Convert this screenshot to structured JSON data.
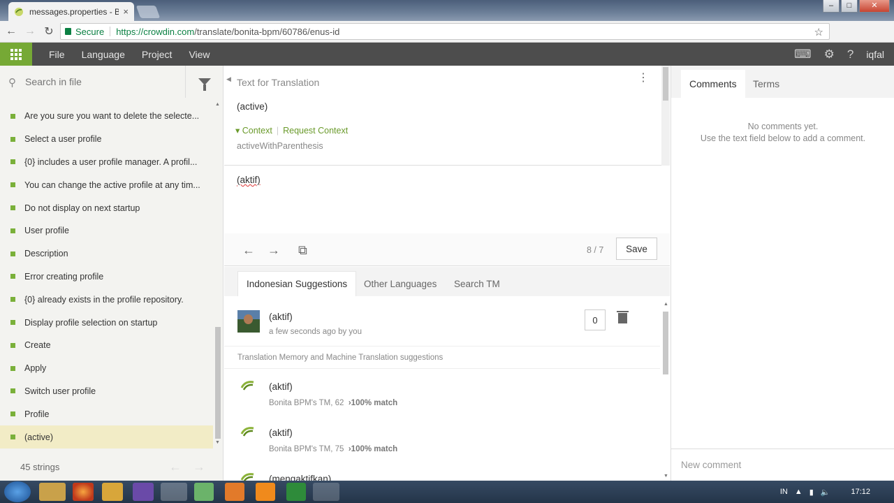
{
  "browser": {
    "tab_title": "messages.properties - Bonita",
    "tab_close": "×",
    "secure_label": "Secure",
    "url_host": "https://crowdin.com",
    "url_path": "/translate/bonita-bpm/60786/enus-id"
  },
  "appbar": {
    "menu": [
      "File",
      "Language",
      "Project",
      "View"
    ],
    "user": "iqfal"
  },
  "left": {
    "search_placeholder": "Search in file",
    "strings": [
      "Are you sure you want to delete the selecte...",
      "Select a user profile",
      "{0} includes a user profile manager. A profil...",
      "You can change the active profile at any tim...",
      "Do not display on next startup",
      "User profile",
      "Description",
      "Error creating profile",
      "{0} already exists in the profile repository.",
      "Display profile selection on startup",
      "Create",
      "Apply",
      "Switch user profile",
      "Profile",
      "(active)"
    ],
    "selected_index": 14,
    "count": "45 strings"
  },
  "editor": {
    "source_header": "Text for Translation",
    "source_text": "(active)",
    "context_label": "Context",
    "request_context": "Request Context",
    "context_key": "activeWithParenthesis",
    "translation": "(aktif)",
    "counter": "8 / 7",
    "save": "Save",
    "tabs": [
      "Indonesian Suggestions",
      "Other Languages",
      "Search TM"
    ],
    "my_suggestion": {
      "text": "(aktif)",
      "meta": "a few seconds ago by you",
      "votes": "0"
    },
    "tm_header": "Translation Memory and Machine Translation suggestions",
    "tm_items": [
      {
        "text": "(aktif)",
        "source": "Bonita BPM's TM, 62",
        "match": "›100% match"
      },
      {
        "text": "(aktif)",
        "source": "Bonita BPM's TM, 75",
        "match": "›100% match"
      },
      {
        "text": "(mengaktifkan)",
        "source": "",
        "match": ""
      }
    ]
  },
  "right": {
    "tabs": [
      "Comments",
      "Terms"
    ],
    "no_comments": "No comments yet.",
    "hint": "Use the text field below to add a comment.",
    "new_comment_placeholder": "New comment"
  },
  "taskbar": {
    "lang": "IN",
    "time": "17:12"
  },
  "colors": {
    "accent": "#76a935",
    "appbar": "#4d4d4d",
    "link": "#6a9a2b"
  }
}
